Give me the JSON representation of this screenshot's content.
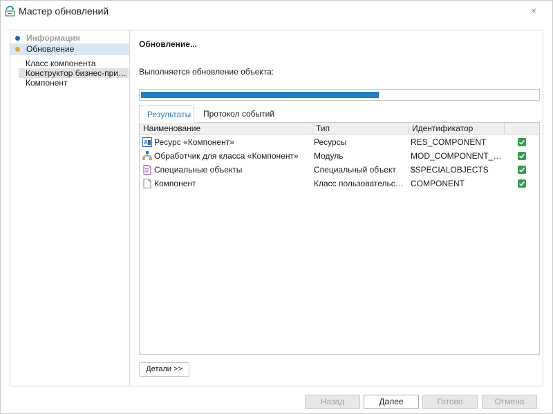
{
  "window": {
    "title": "Мастер обновлений",
    "close_glyph": "×",
    "icon": "update-wizard-icon"
  },
  "sidebar": {
    "steps": [
      {
        "label": "Информация",
        "state": "done",
        "dot_color": "#1565c0"
      },
      {
        "label": "Обновление",
        "state": "active",
        "dot_color": "#f0a030"
      }
    ],
    "substeps": [
      {
        "label": "Класс компонента"
      },
      {
        "label": "Конструктор бизнес-прило...",
        "selected": true
      },
      {
        "label": "Компонент"
      }
    ]
  },
  "main": {
    "heading": "Обновление...",
    "status": "Выполняется обновление объекта:",
    "progress": 0.6
  },
  "tabs": [
    {
      "label": "Результаты",
      "active": true
    },
    {
      "label": "Протокол событий",
      "active": false
    }
  ],
  "table": {
    "columns": [
      "Наименование",
      "Тип",
      "Идентификатор"
    ],
    "rows": [
      {
        "icon": "resource-icon",
        "name": "Ресурс «Компонент»",
        "type": "Ресурсы",
        "id": "RES_COMPONENT",
        "ok": true
      },
      {
        "icon": "handler-icon",
        "name": "Обработчик для класса «Компонент»",
        "type": "Модуль",
        "id": "MOD_COMPONENT_C...",
        "ok": true
      },
      {
        "icon": "special-objects-icon",
        "name": "Специальные объекты",
        "type": "Специальный объект",
        "id": "$SPECIALOBJECTS",
        "ok": true
      },
      {
        "icon": "document-icon",
        "name": "Компонент",
        "type": "Класс пользовательски...",
        "id": "COMPONENT",
        "ok": true
      }
    ]
  },
  "buttons": {
    "details": "Детали >>",
    "back": "Назад",
    "next": "Далее",
    "finish": "Готово",
    "cancel": "Отмена"
  },
  "colors": {
    "accent": "#1e7ec8",
    "tab_active": "#2b79b6",
    "selection": "#d7e7f4",
    "success": "#2fa14c"
  }
}
